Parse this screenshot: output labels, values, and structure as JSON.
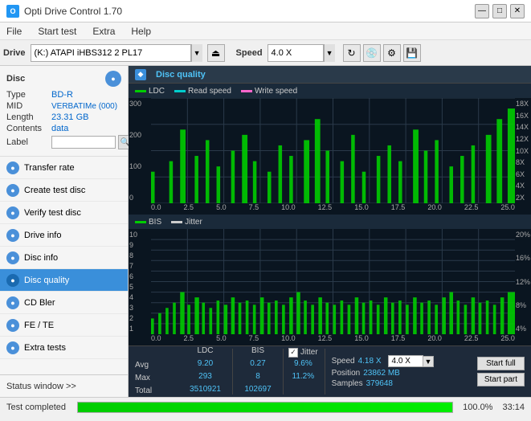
{
  "titleBar": {
    "title": "Opti Drive Control 1.70",
    "minimizeBtn": "—",
    "maximizeBtn": "□",
    "closeBtn": "✕"
  },
  "menuBar": {
    "items": [
      "File",
      "Start test",
      "Extra",
      "Help"
    ]
  },
  "driveToolbar": {
    "driveLabel": "Drive",
    "driveValue": "(K:)  ATAPI iHBS312  2 PL17",
    "speedLabel": "Speed",
    "speedValue": "4.0 X"
  },
  "discPanel": {
    "title": "Disc",
    "typeLabel": "Type",
    "typeValue": "BD-R",
    "midLabel": "MID",
    "midValue": "VERBATIMe (000)",
    "lengthLabel": "Length",
    "lengthValue": "23.31 GB",
    "contentsLabel": "Contents",
    "contentsValue": "data",
    "labelLabel": "Label"
  },
  "navItems": [
    {
      "id": "transfer-rate",
      "label": "Transfer rate",
      "color": "#4a90d9"
    },
    {
      "id": "create-test-disc",
      "label": "Create test disc",
      "color": "#4a90d9"
    },
    {
      "id": "verify-test-disc",
      "label": "Verify test disc",
      "color": "#4a90d9"
    },
    {
      "id": "drive-info",
      "label": "Drive info",
      "color": "#4a90d9"
    },
    {
      "id": "disc-info",
      "label": "Disc info",
      "color": "#4a90d9"
    },
    {
      "id": "disc-quality",
      "label": "Disc quality",
      "color": "#4a90d9",
      "active": true
    },
    {
      "id": "cd-bler",
      "label": "CD Bler",
      "color": "#4a90d9"
    },
    {
      "id": "fe-te",
      "label": "FE / TE",
      "color": "#4a90d9"
    },
    {
      "id": "extra-tests",
      "label": "Extra tests",
      "color": "#4a90d9"
    }
  ],
  "statusWindow": {
    "label": "Status window >> "
  },
  "chartTitle": "Disc quality",
  "topChartLegend": {
    "ldc": "LDC",
    "readSpeed": "Read speed",
    "writeSpeed": "Write speed"
  },
  "topChart": {
    "yAxisLeft": [
      "300",
      "200",
      "100",
      "0"
    ],
    "yAxisRight": [
      "18X",
      "16X",
      "14X",
      "12X",
      "10X",
      "8X",
      "6X",
      "4X",
      "2X"
    ],
    "xAxis": [
      "0.0",
      "2.5",
      "5.0",
      "7.5",
      "10.0",
      "12.5",
      "15.0",
      "17.5",
      "20.0",
      "22.5",
      "25.0"
    ]
  },
  "bottomChartLegend": {
    "bis": "BIS",
    "jitter": "Jitter"
  },
  "bottomChart": {
    "yAxisLeft": [
      "10",
      "9",
      "8",
      "7",
      "6",
      "5",
      "4",
      "3",
      "2",
      "1"
    ],
    "yAxisRight": [
      "20%",
      "16%",
      "12%",
      "8%",
      "4%"
    ],
    "xAxis": [
      "0.0",
      "2.5",
      "5.0",
      "7.5",
      "10.0",
      "12.5",
      "15.0",
      "17.5",
      "20.0",
      "22.5",
      "25.0"
    ]
  },
  "statsBar": {
    "ldcLabel": "LDC",
    "bisLabel": "BIS",
    "jitterLabel": "Jitter",
    "speedLabel": "Speed",
    "positionLabel": "Position",
    "samplesLabel": "Samples",
    "avgLDC": "9.20",
    "avgBIS": "0.27",
    "avgJitter": "9.6%",
    "maxLDC": "293",
    "maxBIS": "8",
    "maxJitter": "11.2%",
    "totalLDC": "3510921",
    "totalBIS": "102697",
    "speedValue": "4.18 X",
    "speedDropdown": "4.0 X",
    "position": "23862 MB",
    "samples": "379648",
    "avgLabel": "Avg",
    "maxLabel": "Max",
    "totalLabel": "Total",
    "startFullLabel": "Start full",
    "startPartLabel": "Start part"
  },
  "progressArea": {
    "statusText": "Test completed",
    "percent": "100.0%",
    "time": "33:14"
  }
}
